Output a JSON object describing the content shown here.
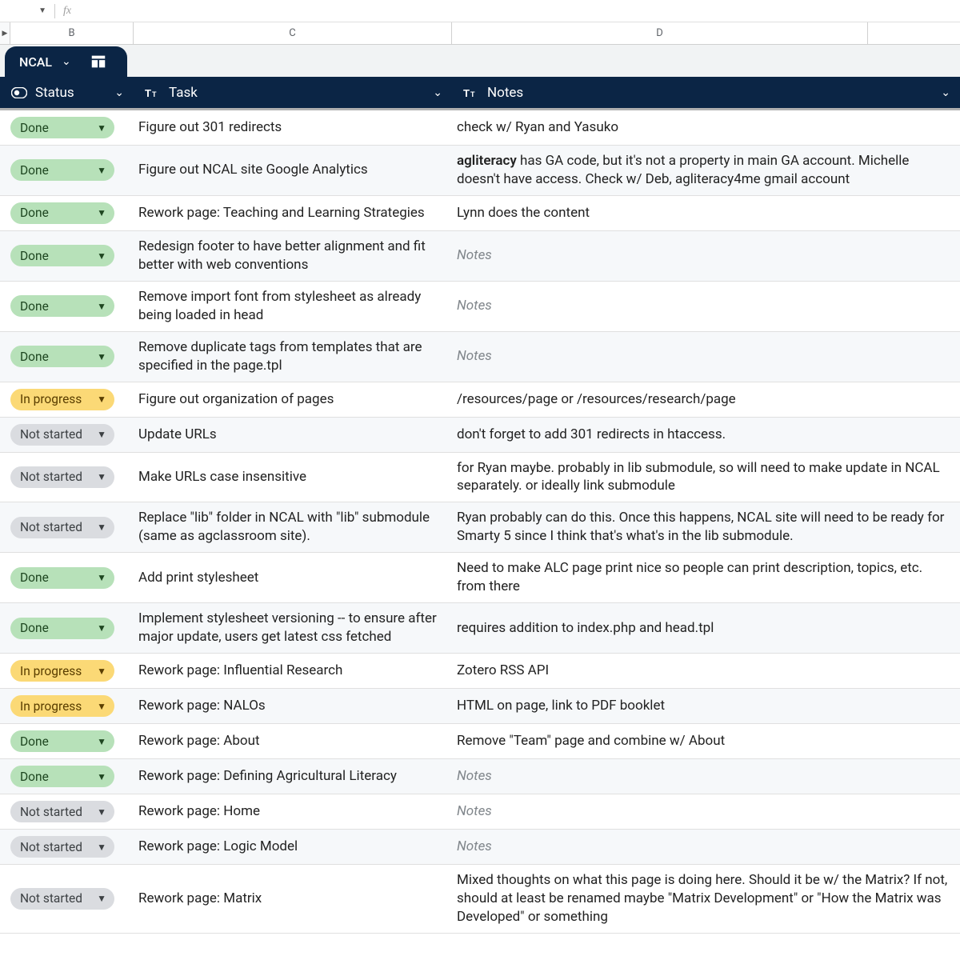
{
  "formula_bar": {
    "fx": "fx"
  },
  "columns": {
    "b": "B",
    "c": "C",
    "d": "D"
  },
  "tab": {
    "name": "NCAL"
  },
  "header": {
    "status": "Status",
    "task": "Task",
    "notes": "Notes"
  },
  "status_labels": {
    "done": "Done",
    "in_progress": "In progress",
    "not_started": "Not started"
  },
  "notes_placeholder": "Notes",
  "rows": [
    {
      "status": "done",
      "task": "Figure out 301 redirects",
      "notes": "check w/ Ryan and Yasuko"
    },
    {
      "status": "done",
      "task": "Figure out NCAL site Google Analytics",
      "notes_lead": "agliteracy",
      "notes_rest": " has GA code, but it's not a property in main GA account. Michelle doesn't have access. Check w/ Deb, agliteracy4me gmail account"
    },
    {
      "status": "done",
      "task": "Rework page: Teaching and Learning Strategies",
      "notes": "Lynn does the content"
    },
    {
      "status": "done",
      "task": "Redesign footer to have better alignment and fit better with web conventions",
      "notes": null
    },
    {
      "status": "done",
      "task": "Remove import font from stylesheet as already being loaded in head",
      "notes": null
    },
    {
      "status": "done",
      "task": "Remove duplicate tags from templates that are specified in the page.tpl",
      "notes": null
    },
    {
      "status": "in_progress",
      "task": "Figure out organization of pages",
      "notes": "/resources/page or /resources/research/page"
    },
    {
      "status": "not_started",
      "task": "Update URLs",
      "notes": "don't forget to add 301 redirects in htaccess."
    },
    {
      "status": "not_started",
      "task": "Make URLs case insensitive",
      "notes": "for Ryan maybe. probably in lib submodule, so will need to make update in NCAL separately. or ideally link submodule"
    },
    {
      "status": "not_started",
      "task": "Replace \"lib\" folder in NCAL with \"lib\" submodule (same as agclassroom site).",
      "notes": "Ryan probably can do this. Once this happens, NCAL site will need to be ready for Smarty 5 since I think that's what's in the lib submodule."
    },
    {
      "status": "done",
      "task": "Add print stylesheet",
      "notes": "Need to make ALC page print nice so people can print description, topics, etc. from there"
    },
    {
      "status": "done",
      "task": "Implement stylesheet versioning -- to ensure after major update, users get latest css fetched",
      "notes": "requires addition to index.php and head.tpl"
    },
    {
      "status": "in_progress",
      "task": "Rework page: Influential Research",
      "notes": "Zotero RSS API"
    },
    {
      "status": "in_progress",
      "task": "Rework page: NALOs",
      "notes": "HTML on page, link to PDF booklet"
    },
    {
      "status": "done",
      "task": "Rework page: About",
      "notes": "Remove \"Team\" page and combine w/ About"
    },
    {
      "status": "done",
      "task": "Rework page: Defining Agricultural Literacy",
      "notes": null
    },
    {
      "status": "not_started",
      "task": "Rework page: Home",
      "notes": null
    },
    {
      "status": "not_started",
      "task": "Rework page: Logic Model",
      "notes": null
    },
    {
      "status": "not_started",
      "task": "Rework page: Matrix",
      "notes": "Mixed thoughts on what this page is doing here. Should it be w/ the Matrix? If not, should at least be renamed maybe \"Matrix Development\" or \"How the Matrix was Developed\" or something"
    }
  ]
}
